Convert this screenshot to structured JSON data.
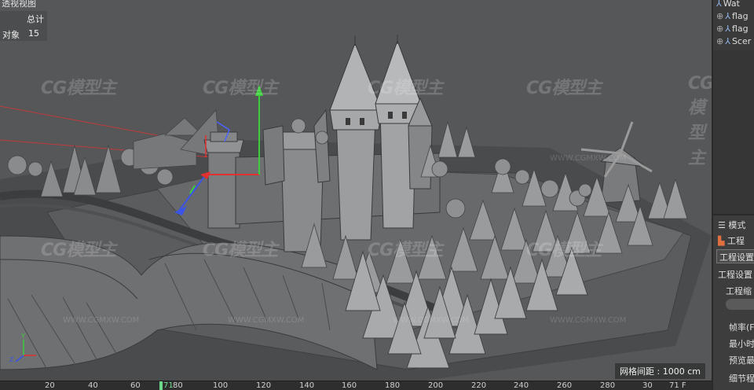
{
  "viewport": {
    "title": "透视视图",
    "hud": {
      "total_label": "总计",
      "objects_label": "对象",
      "objects_value": "15"
    },
    "grid_spacing": "网格间距 : 1000 cm",
    "watermark_text": "CG模型主",
    "watermark_url": "WWW.CGMXW.COM",
    "axis_colors": {
      "x": "#e03030",
      "y": "#3ccf3c",
      "z": "#3a54e8"
    }
  },
  "object_manager": {
    "items": [
      {
        "tree": "",
        "label": "Wat"
      },
      {
        "tree": "⊕",
        "label": "flag"
      },
      {
        "tree": "⊕",
        "label": "flag"
      },
      {
        "tree": "⊕",
        "label": "Scer"
      }
    ]
  },
  "attributes": {
    "mode_label": "模式",
    "project_label": "工程",
    "tab_active": "工程设置",
    "section_label": "工程设置",
    "scale_label": "工程缩",
    "fps_label": "帧率(F",
    "min_time_label": "最小时",
    "preview_label": "预览最",
    "detail_label": "细节程"
  },
  "timeline": {
    "ticks": [
      "20",
      "40",
      "60",
      "80",
      "100",
      "120",
      "140",
      "160",
      "180",
      "200",
      "220",
      "240",
      "260",
      "280",
      "30"
    ],
    "current_frame": "71",
    "current_suffix": "80",
    "right_readout": "71 F"
  }
}
